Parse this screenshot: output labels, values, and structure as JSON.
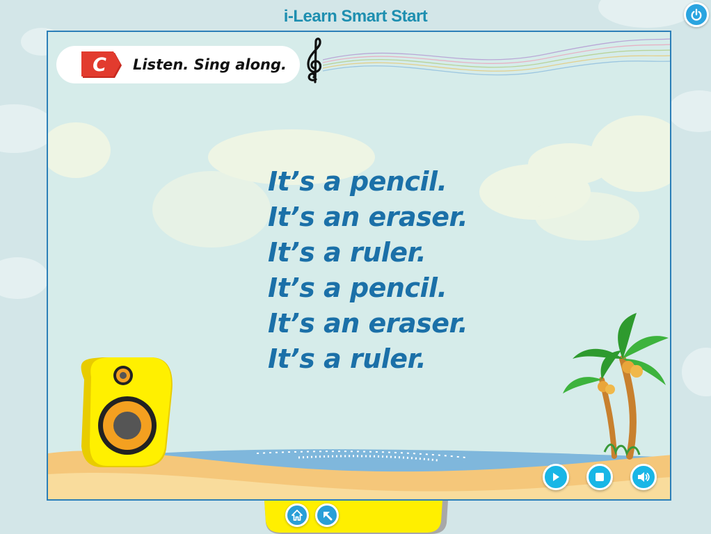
{
  "app": {
    "title": "i-Learn Smart Start"
  },
  "activity": {
    "badge_letter": "C",
    "instruction": "Listen. Sing along."
  },
  "lyrics": [
    "It’s a pencil.",
    "It’s an eraser.",
    "It’s a ruler.",
    "It’s a pencil.",
    "It’s an eraser.",
    "It’s a ruler."
  ],
  "controls": {
    "play": "play-icon",
    "stop": "stop-icon",
    "volume": "volume-icon"
  },
  "nav": {
    "home": "home-icon",
    "back": "back-arrow-icon",
    "power": "power-icon"
  },
  "colors": {
    "title": "#1e8fb0",
    "lyrics": "#1b70a8",
    "badge": "#e23b2e",
    "button": "#19b6e6"
  }
}
